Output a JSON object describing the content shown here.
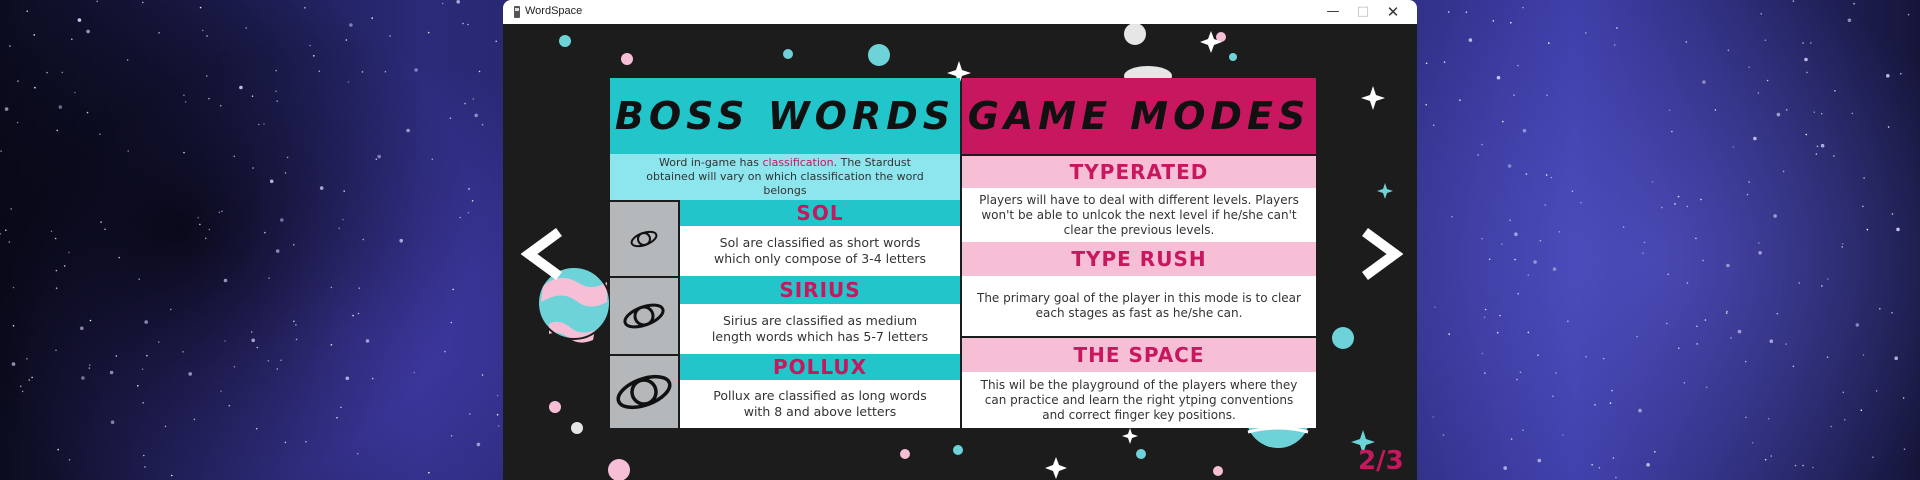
{
  "window": {
    "title": "WordSpace"
  },
  "boss_words": {
    "title": "BOSS WORDS",
    "intro_before": "Word in-game has ",
    "intro_highlight": "classification",
    "intro_after": ". The Stardust obtained will vary on which classification the word belongs",
    "classes": [
      {
        "name": "SOL",
        "description": "Sol are classified as short words which only compose of 3-4 letters",
        "icon": "planet-ring-small-icon"
      },
      {
        "name": "SIRIUS",
        "description": "Sirius are classified as medium length words which has 5-7 letters",
        "icon": "planet-ring-medium-icon"
      },
      {
        "name": "POLLUX",
        "description": "Pollux are classified as long words with 8 and above letters",
        "icon": "planet-ring-large-icon"
      }
    ]
  },
  "game_modes": {
    "title": "GAME MODES",
    "modes": [
      {
        "name": "TYPERATED",
        "description": "Players will have to deal with different levels. Players won't be able to unlcok the next level if he/she can't clear the previous levels."
      },
      {
        "name": "TYPE RUSH",
        "description": "The primary goal of the player in this mode is to clear each stages as fast as he/she can."
      },
      {
        "name": "THE SPACE",
        "description": "This wil be the playground of the players where they can practice and learn the right ytping conventions and correct finger key positions."
      }
    ]
  },
  "navigation": {
    "prev_icon": "chevron-left-icon",
    "next_icon": "chevron-right-icon",
    "page_indicator": "2/3"
  },
  "colors": {
    "teal": "#22c5c9",
    "light_teal": "#8de6ee",
    "magenta": "#c7175e",
    "light_pink": "#f7bfd6",
    "gray": "#b4b8ba",
    "panel_bg": "#1c1c1c"
  }
}
